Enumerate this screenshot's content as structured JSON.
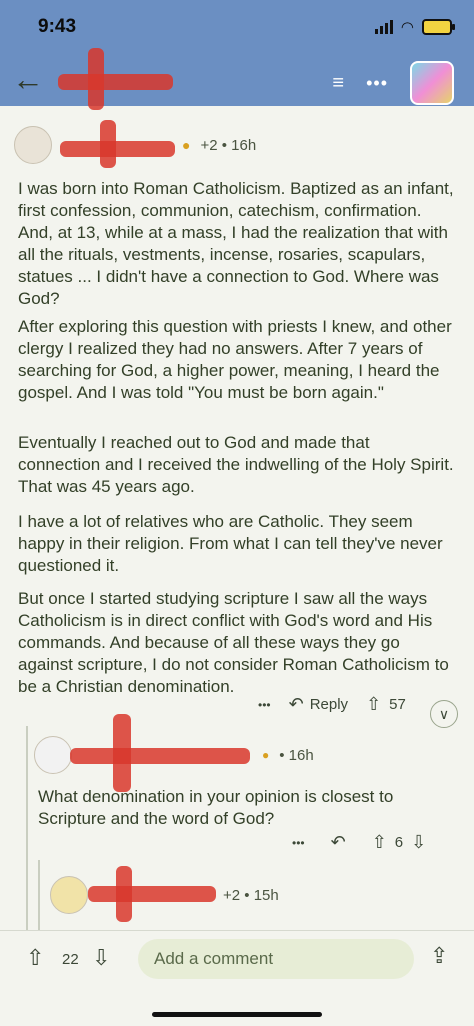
{
  "status": {
    "time": "9:43"
  },
  "header": {
    "back_icon": "arrow-left-icon",
    "filter_icon": "filter-icon",
    "more_icon": "more-icon"
  },
  "comment1": {
    "meta": "+2 • 16h",
    "paragraphs": [
      "I was born into Roman Catholicism. Baptized as an infant, first confession, communion, catechism, confirmation. And, at 13, while at a mass, I had the realization that with all the rituals, vestments, incense, rosaries, scapulars, statues ... I didn't have a connection to God. Where was God?",
      "After exploring this question with priests I knew, and other clergy I realized they had no answers. After 7 years of searching for God, a higher power, meaning, I heard the gospel. And I was told \"You must be born again.\"",
      "Eventually I reached out to God and made that connection and I received the indwelling of the Holy Spirit. That was 45 years ago.",
      "I have a lot of relatives who are Catholic. They seem happy in their religion. From what I can tell they've never questioned it.",
      "But once I started studying scripture I saw all the ways Catholicism is in direct conflict with God's word and His commands. And because of all these ways they go against scripture, I do not consider Roman Catholicism to be a Christian denomination."
    ],
    "more": "•••",
    "reply": "Reply",
    "votes": "57"
  },
  "comment2": {
    "meta": "• 16h",
    "text": "What denomination in your opinion is closest to Scripture and the word of God?",
    "more": "•••",
    "votes": "6"
  },
  "comment3": {
    "meta": "+2 • 15h"
  },
  "bottom": {
    "votes": "22",
    "placeholder": "Add a comment"
  }
}
